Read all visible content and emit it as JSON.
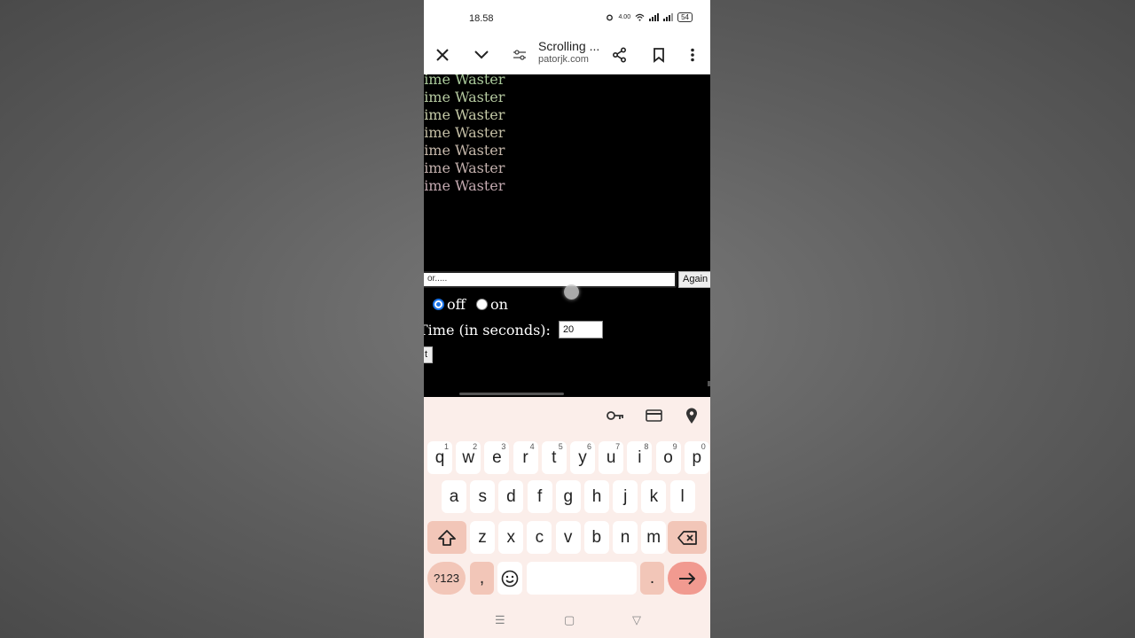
{
  "status_bar": {
    "time": "18.58",
    "net_speed": "4.00",
    "battery": "54"
  },
  "toolbar": {
    "title": "Scrolling ...",
    "domain": "patorjk.com"
  },
  "page": {
    "waster_lines": [
      {
        "text": "t Time Waster",
        "color": "#a9c99a"
      },
      {
        "text": "t Time Waster",
        "color": "#b5c9a0"
      },
      {
        "text": "t Time Waster",
        "color": "#c4c9a6"
      },
      {
        "text": "t Time Waster",
        "color": "#c5bfa6"
      },
      {
        "text": "t Time Waster",
        "color": "#c5b7aa"
      },
      {
        "text": "t Time Waster",
        "color": "#c3b0ad"
      },
      {
        "text": "t Time Waster",
        "color": "#c3a9b0"
      }
    ],
    "text_input_value": "or.....",
    "again_label": "Again",
    "radio_off_label": "off",
    "radio_on_label": "on",
    "time_label": "Time (in seconds):",
    "time_value": "20",
    "start_label": "t"
  },
  "keyboard": {
    "row1": [
      {
        "key": "q",
        "hint": "1"
      },
      {
        "key": "w",
        "hint": "2"
      },
      {
        "key": "e",
        "hint": "3"
      },
      {
        "key": "r",
        "hint": "4"
      },
      {
        "key": "t",
        "hint": "5"
      },
      {
        "key": "y",
        "hint": "6"
      },
      {
        "key": "u",
        "hint": "7"
      },
      {
        "key": "i",
        "hint": "8"
      },
      {
        "key": "o",
        "hint": "9"
      },
      {
        "key": "p",
        "hint": "0"
      }
    ],
    "row2": [
      "a",
      "s",
      "d",
      "f",
      "g",
      "h",
      "j",
      "k",
      "l"
    ],
    "row3": [
      "z",
      "x",
      "c",
      "v",
      "b",
      "n",
      "m"
    ],
    "symbols_label": "?123",
    "comma": ",",
    "period": "."
  },
  "icons": {
    "close": "close-icon",
    "down": "chevron-down-icon",
    "settings": "tune-icon",
    "share": "share-icon",
    "bookmark": "bookmark-icon",
    "more": "more-vert-icon",
    "key": "key-icon",
    "card": "credit-card-icon",
    "location": "location-pin-icon",
    "shift": "shift-icon",
    "backspace": "backspace-icon",
    "emoji": "emoji-icon",
    "enter": "arrow-right-icon"
  },
  "colors": {
    "keyboard_bg": "#fbeeea",
    "modifier_key": "#f2c6b8",
    "enter_key": "#f19a90",
    "radio_accent": "#1a73e8"
  }
}
